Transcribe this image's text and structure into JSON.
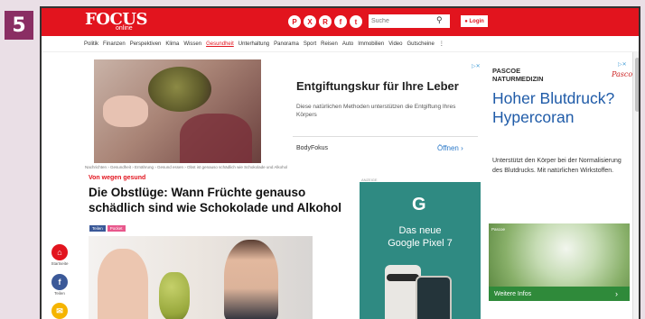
{
  "step_number": "5",
  "header": {
    "logo": "FOCUS",
    "logo_sub": "online",
    "search_placeholder": "Suche",
    "login_label": "Login"
  },
  "nav": {
    "items": [
      "Politik",
      "Finanzen",
      "Perspektiven",
      "Klima",
      "Wissen",
      "Gesundheit",
      "Unterhaltung",
      "Panorama",
      "Sport",
      "Reisen",
      "Auto",
      "Immobilien",
      "Video",
      "Gutscheine"
    ],
    "active_index": 5
  },
  "ad_top": {
    "title": "Entgiftungskur für Ihre Leber",
    "text": "Diese natürlichen Methoden unterstützen die Entgiftung Ihres Körpers",
    "brand": "BodyFokus",
    "cta": "Öffnen"
  },
  "article": {
    "breadcrumb": "Nachrichten › Gesundheit › Ernährung › Gesund essen › Obst ist genauso schädlich wie Schokolade und Alkohol",
    "kicker": "Von wegen gesund",
    "headline": "Die Obstlüge: Wann Früchte genauso schädlich sind wie Schokolade und Alkohol",
    "share_facebook": "Teilen",
    "share_pocket": "Pocket"
  },
  "side_actions": {
    "home_label": "Startseite",
    "facebook_label": "Teilen"
  },
  "ad_google": {
    "label": "ANZEIGE",
    "logo": "G",
    "line1": "Das neue",
    "line2": "Google Pixel 7"
  },
  "ad_right": {
    "brand_line1": "PASCOE",
    "brand_line2": "NATURMEDIZIN",
    "brand_logo": "Pascoe",
    "title": "Hoher Blutdruck? Hypercoran",
    "text": "Unterstützt den Körper bei der Normalisierung des Blutdrucks. Mit natürlichen Wirkstoffen.",
    "img_label": "Pascoe",
    "cta": "Weitere Infos"
  }
}
